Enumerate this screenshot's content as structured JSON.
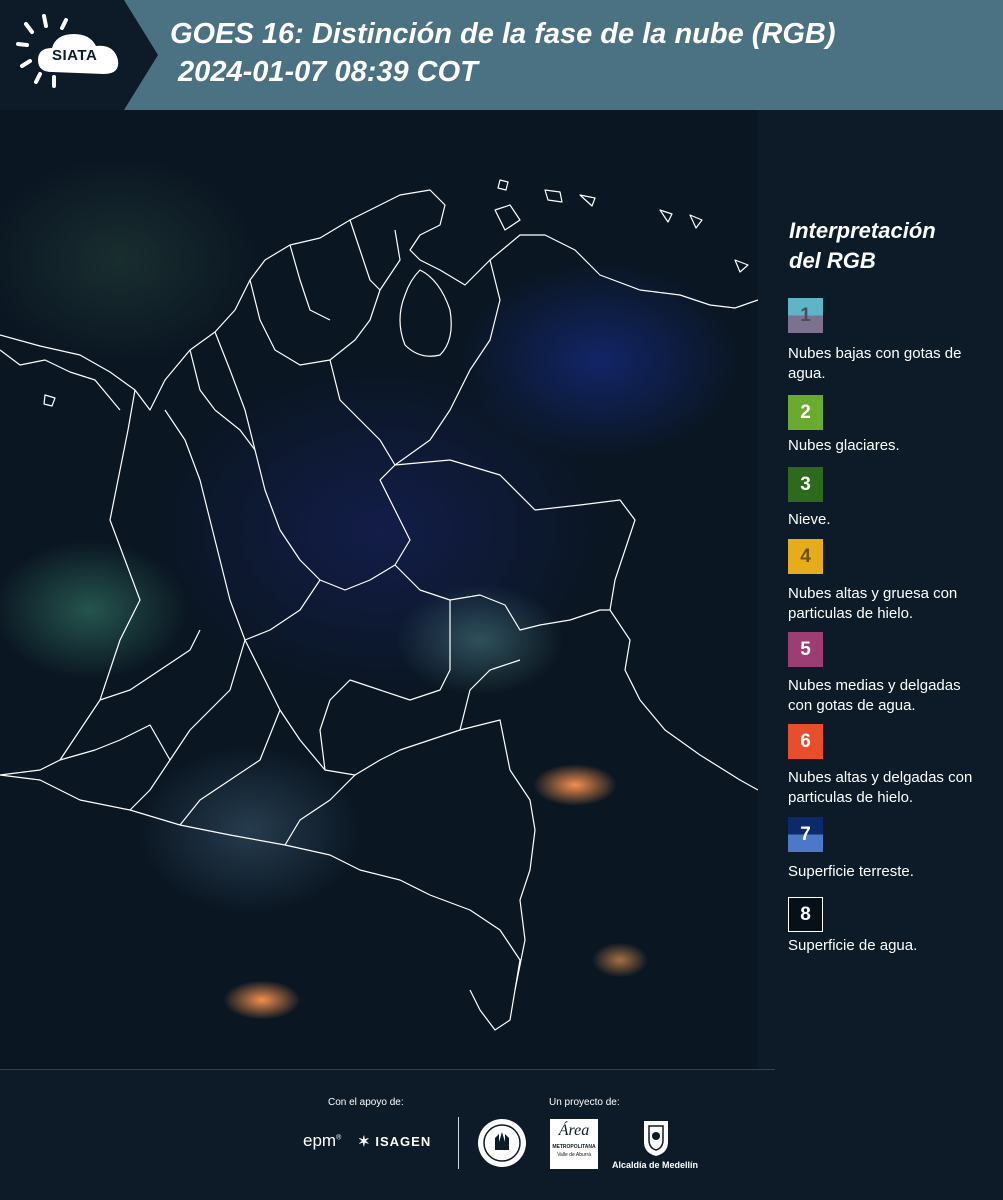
{
  "header": {
    "logo_text": "SIATA",
    "title_line1": "GOES 16: Distinción de la fase de la nube (RGB)",
    "title_line2": " 2024-01-07 08:39 COT"
  },
  "legend": {
    "title_line1": "Interpretación",
    "title_line2": "del RGB",
    "items": [
      {
        "number": "1",
        "label": "Nubes bajas con gotas de agua.",
        "color_top": "#5fb4c6",
        "color_bottom": "#7d7190",
        "text_color": "#4b4b5a"
      },
      {
        "number": "2",
        "label": "Nubes glaciares.",
        "color_top": "#6aaa2e",
        "color_bottom": "#6aaa2e",
        "text_color": "#ffffff"
      },
      {
        "number": "3",
        "label": "Nieve.",
        "color_top": "#2d6a1d",
        "color_bottom": "#2d6a1d",
        "text_color": "#ffffff"
      },
      {
        "number": "4",
        "label": "Nubes altas y gruesa con particulas de hielo.",
        "color_top": "#e5ad1c",
        "color_bottom": "#e5ad1c",
        "text_color": "#6a4f10"
      },
      {
        "number": "5",
        "label": "Nubes medias y delgadas con gotas de agua.",
        "color_top": "#9c3e74",
        "color_bottom": "#9c3e74",
        "text_color": "#ffffff"
      },
      {
        "number": "6",
        "label": "Nubes altas y delgadas con particulas de hielo.",
        "color_top": "#e74f2c",
        "color_bottom": "#e74f2c",
        "text_color": "#ffffff"
      },
      {
        "number": "7",
        "label": "Superficie terreste.",
        "color_top": "#0c2a6b",
        "color_bottom": "#4b79c8",
        "text_color": "#ffffff"
      },
      {
        "number": "8",
        "label": "Superficie de agua.",
        "color_top": "#071018",
        "color_bottom": "#071018",
        "text_color": "#ffffff"
      }
    ]
  },
  "footer": {
    "support_label": "Con el apoyo de:",
    "project_label": "Un proyecto de:",
    "sponsor_epm": "epm",
    "sponsor_isagen": "ISAGEN",
    "sponsor_area_top": "Área",
    "sponsor_area_sub": "METROPOLITANA",
    "sponsor_area_sub2": "Valle de Aburrá",
    "sponsor_alcaldia": "Alcaldía de Medellín"
  },
  "colors": {
    "header_bg": "#4b7283",
    "page_bg": "#0c1b27",
    "map_border": "#ffffff"
  }
}
